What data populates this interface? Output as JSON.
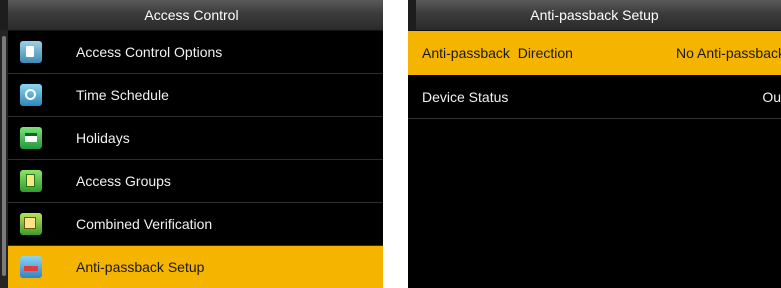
{
  "left_panel": {
    "title": "Access Control",
    "items": [
      {
        "label": "Access Control Options"
      },
      {
        "label": "Time Schedule"
      },
      {
        "label": "Holidays"
      },
      {
        "label": "Access Groups"
      },
      {
        "label": "Combined Verification"
      },
      {
        "label": "Anti-passback Setup"
      }
    ]
  },
  "right_panel": {
    "title": "Anti-passback Setup",
    "settings": [
      {
        "name": "Anti-passback  Direction",
        "value": "No Anti-passback"
      },
      {
        "name": "Device Status",
        "value": "Out"
      }
    ]
  },
  "colors": {
    "highlight": "#f5b400",
    "background": "#000000",
    "text": "#f2f2f2"
  }
}
